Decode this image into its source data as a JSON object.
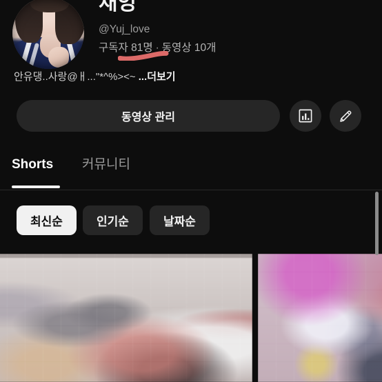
{
  "app": {
    "background_color": "#0d0d0d",
    "surface_color": "#262626",
    "accent_text_color": "#f1f1f1",
    "muted_text_color": "#9a9a9a"
  },
  "profile": {
    "channel_name": "채잉",
    "handle": "@Yuj_love",
    "subscribers": "구독자 81명",
    "separator": "·",
    "video_count": "동영상 10개",
    "bio": "안유댕..사랑@ㅐ...\"*^%><~",
    "bio_more_label": "...더보기",
    "avatar_alt": "channel-avatar"
  },
  "annotation": {
    "underline_color": "#e8706e",
    "target": "구독자 81명"
  },
  "actions": {
    "manage_videos_label": "동영상 관리",
    "analytics_icon": "bar-chart-icon",
    "edit_icon": "pencil-icon"
  },
  "tabs": {
    "items": [
      {
        "label": "Shorts",
        "active": true
      },
      {
        "label": "커뮤니티",
        "active": false
      }
    ]
  },
  "filters": {
    "chips": [
      {
        "label": "최신순",
        "active": true
      },
      {
        "label": "인기순",
        "active": false
      },
      {
        "label": "날짜순",
        "active": false
      }
    ]
  },
  "shorts_grid": {
    "items": [
      {
        "name": "shorts-thumbnail-1",
        "censored": true
      },
      {
        "name": "shorts-thumbnail-2",
        "censored": true
      }
    ]
  },
  "scrollbar": {
    "orientation": "vertical",
    "position": "right"
  }
}
